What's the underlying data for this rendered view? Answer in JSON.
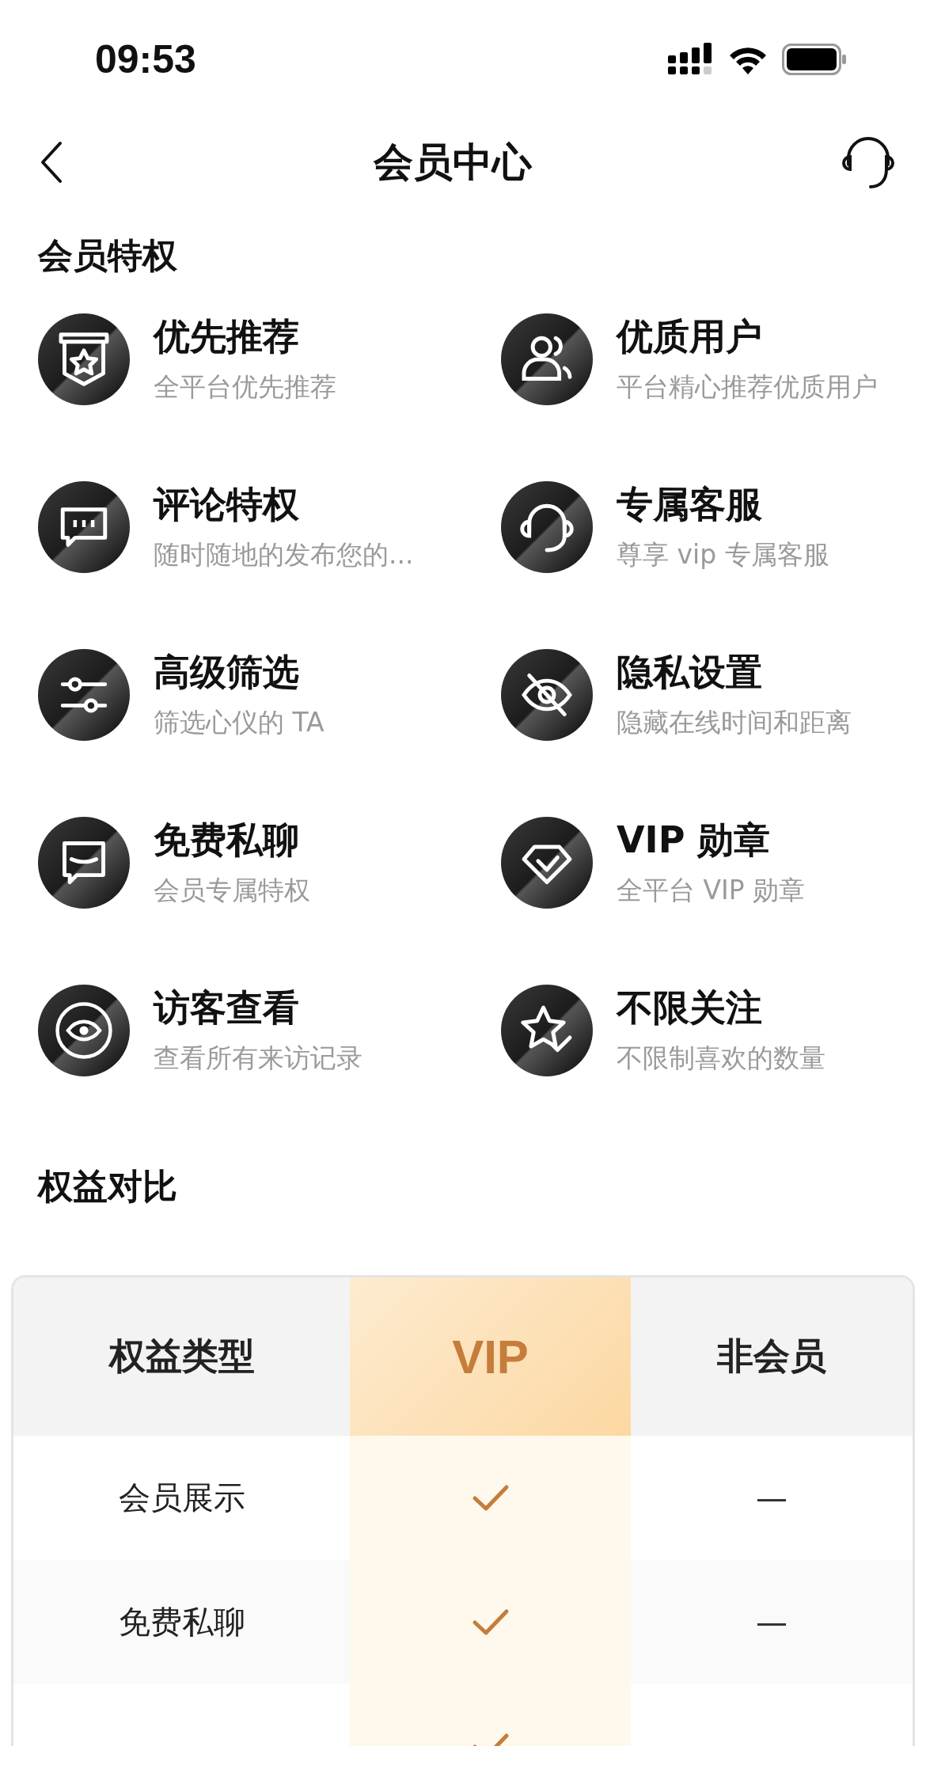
{
  "status_bar": {
    "time": "09:53"
  },
  "nav": {
    "title": "会员中心"
  },
  "privileges": {
    "title": "会员特权",
    "items": [
      {
        "title": "优先推荐",
        "subtitle": "全平台优先推荐"
      },
      {
        "title": "优质用户",
        "subtitle": "平台精心推荐优质用户"
      },
      {
        "title": "评论特权",
        "subtitle": "随时随地的发布您的..."
      },
      {
        "title": "专属客服",
        "subtitle": "尊享 vip 专属客服"
      },
      {
        "title": "高级筛选",
        "subtitle": "筛选心仪的 TA"
      },
      {
        "title": "隐私设置",
        "subtitle": "隐藏在线时间和距离"
      },
      {
        "title": "免费私聊",
        "subtitle": "会员专属特权"
      },
      {
        "title": "VIP 勋章",
        "subtitle": "全平台 VIP 勋章"
      },
      {
        "title": "访客查看",
        "subtitle": "查看所有来访记录"
      },
      {
        "title": "不限关注",
        "subtitle": "不限制喜欢的数量"
      }
    ]
  },
  "comparison": {
    "title": "权益对比",
    "columns": [
      "权益类型",
      "VIP",
      "非会员"
    ],
    "rows": [
      {
        "label": "会员展示",
        "vip": true,
        "non_member": "—"
      },
      {
        "label": "免费私聊",
        "vip": true,
        "non_member": "—"
      },
      {
        "vip": true
      }
    ]
  }
}
